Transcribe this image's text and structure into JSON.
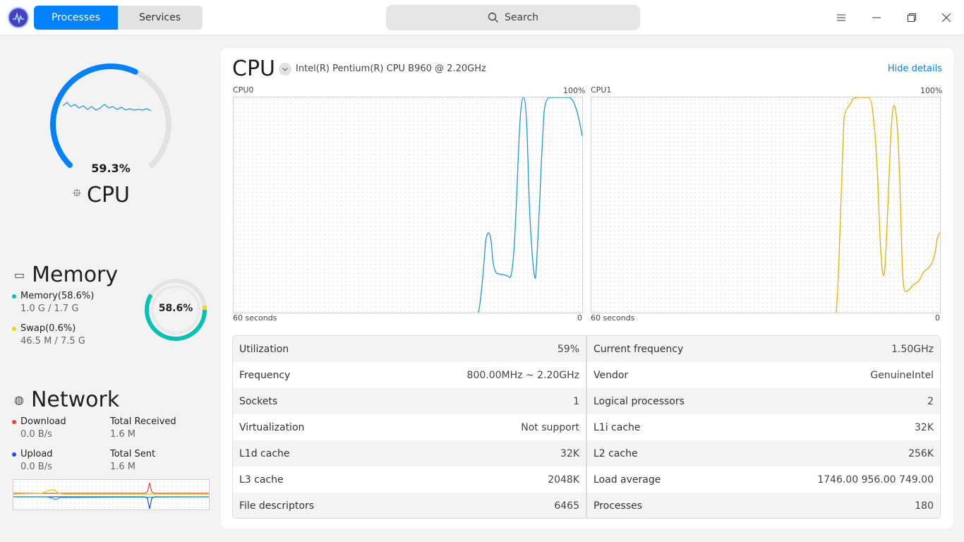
{
  "tabs": {
    "processes": "Processes",
    "services": "Services"
  },
  "search": {
    "label": "Search"
  },
  "cpu_summary": {
    "percent": "59.3%",
    "label": "CPU",
    "gauge_fraction": 0.593
  },
  "memory": {
    "title": "Memory",
    "percent": "58.6%",
    "mem_label": "Memory(58.6%)",
    "mem_value": "1.0 G / 1.7 G",
    "swap_label": "Swap(0.6%)",
    "swap_value": "46.5 M / 7.5 G",
    "mem_fraction": 0.586,
    "swap_fraction": 0.006,
    "colors": {
      "memory": "#00c2b5",
      "swap": "#f5d400"
    }
  },
  "network": {
    "title": "Network",
    "download_label": "Download",
    "download_value": "0.0 B/s",
    "total_received_label": "Total Received",
    "total_received_value": "1.6 M",
    "upload_label": "Upload",
    "upload_value": "0.0 B/s",
    "total_sent_label": "Total Sent",
    "total_sent_value": "1.6 M",
    "colors": {
      "download": "#e84a1c",
      "upload": "#1f4ee0"
    }
  },
  "detail": {
    "title": "CPU",
    "model": "Intel(R) Pentium(R) CPU B960 @ 2.20GHz",
    "hide_details": "Hide details",
    "graphs": [
      {
        "name": "CPU0",
        "max_label": "100%",
        "left_label": "60 seconds",
        "right_label": "0",
        "color": "#1a9bd0"
      },
      {
        "name": "CPU1",
        "max_label": "100%",
        "left_label": "60 seconds",
        "right_label": "0",
        "color": "#e3b000"
      }
    ],
    "table_left": [
      {
        "k": "Utilization",
        "v": "59%"
      },
      {
        "k": "Frequency",
        "v": "800.00MHz ~ 2.20GHz"
      },
      {
        "k": "Sockets",
        "v": "1"
      },
      {
        "k": "Virtualization",
        "v": "Not support"
      },
      {
        "k": "L1d cache",
        "v": "32K"
      },
      {
        "k": "L3 cache",
        "v": "2048K"
      },
      {
        "k": "File descriptors",
        "v": "6465"
      }
    ],
    "table_right": [
      {
        "k": "Current frequency",
        "v": "1.50GHz"
      },
      {
        "k": "Vendor",
        "v": "GenuineIntel"
      },
      {
        "k": "Logical processors",
        "v": "2"
      },
      {
        "k": "L1i cache",
        "v": "32K"
      },
      {
        "k": "L2 cache",
        "v": "256K"
      },
      {
        "k": "Load average",
        "v": "1746.00 956.00 749.00"
      },
      {
        "k": "Processes",
        "v": "180"
      }
    ]
  }
}
